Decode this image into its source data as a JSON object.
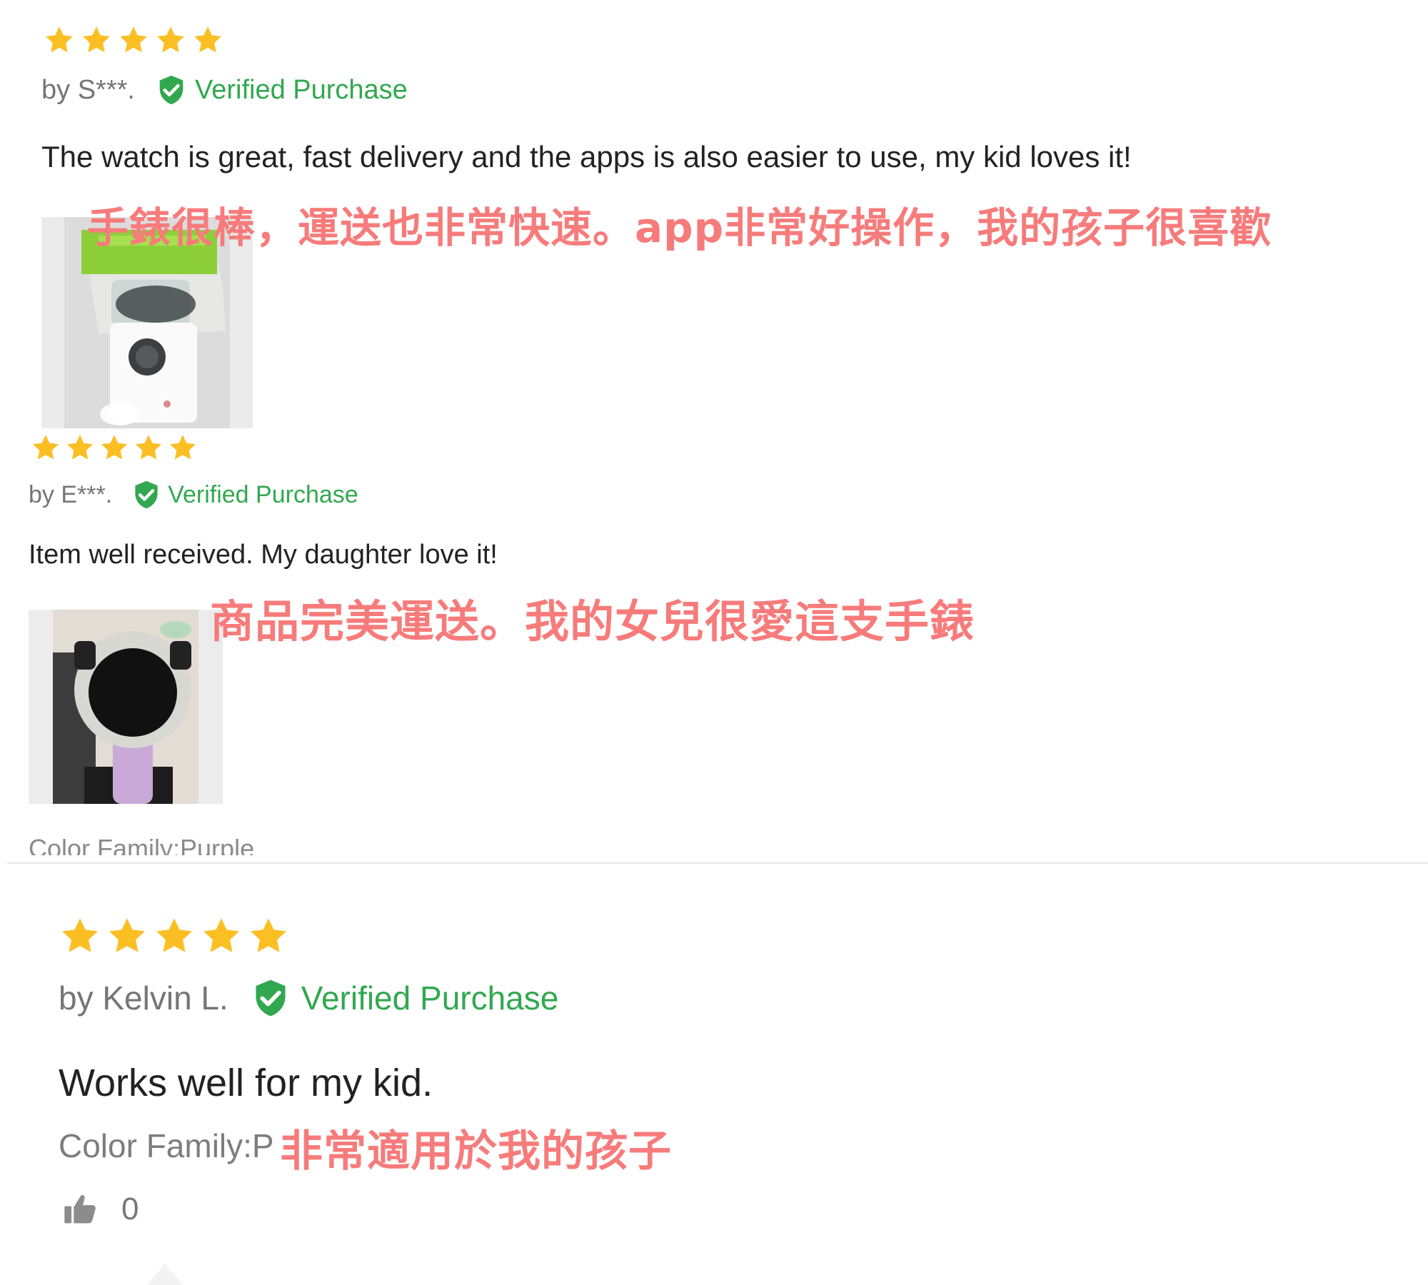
{
  "reviews": [
    {
      "rating": 5,
      "byline": "by S***.",
      "verified_label": "Verified Purchase",
      "text": "The watch is great, fast delivery and the apps is also easier to use, my kid loves it!",
      "translation": "手錶很棒，運送也非常快速。app非常好操作，我的孩子很喜歡"
    },
    {
      "rating": 5,
      "byline": "by E***.",
      "verified_label": "Verified Purchase",
      "text": "Item well received. My daughter love it!",
      "translation": "商品完美運送。我的女兒很愛這支手錶",
      "variant": "Color Family:Purple"
    },
    {
      "rating": 5,
      "byline": "by Kelvin L.",
      "verified_label": "Verified Purchase",
      "text": "Works well for my kid.",
      "variant_prefix": "Color Family:P",
      "translation": "非常適用於我的孩子",
      "likes": "0"
    }
  ],
  "colors": {
    "star": "#fbbf24",
    "verified": "#31a84f",
    "overlay": "#f77b7b",
    "byline": "#757575"
  },
  "icons": [
    "star-icon",
    "verified-shield-icon",
    "thumbs-up-icon"
  ]
}
